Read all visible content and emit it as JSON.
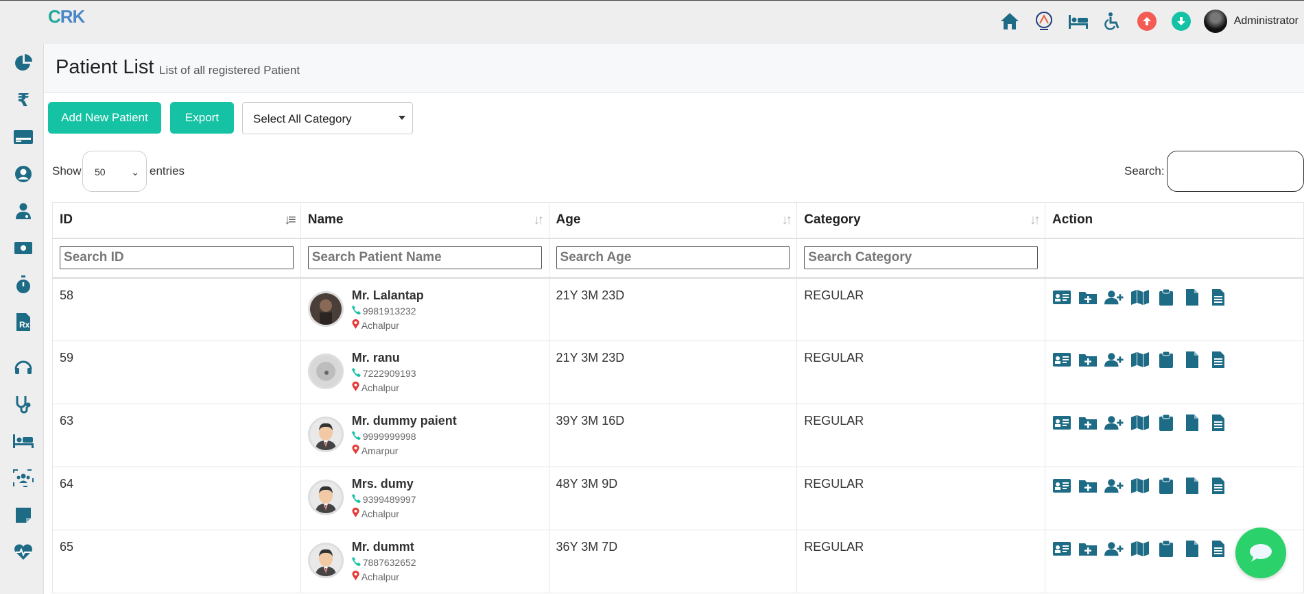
{
  "app": {
    "logo_part1": "C",
    "logo_part2": "RK",
    "user_name": "Administrator"
  },
  "colors": {
    "accent": "#15c3a4",
    "icon": "#1e6b86",
    "up": "#f25c54",
    "down": "#14c2a6",
    "chat": "#2bd16a"
  },
  "topbar": {
    "icons": [
      "home-icon",
      "abha-logo-icon",
      "hospital-bed-icon",
      "wheelchair-icon",
      "arrow-up-circle-icon",
      "arrow-down-circle-icon"
    ]
  },
  "sidebar": {
    "icons": [
      "pie-chart-icon",
      "rupee-icon",
      "id-card-icon",
      "user-circle-icon",
      "doctor-icon",
      "money-icon",
      "stopwatch-icon",
      "prescription-icon",
      "headset-icon",
      "stethoscope-icon",
      "bed-icon",
      "users-icon",
      "sticky-note-icon",
      "heartbeat-icon"
    ]
  },
  "page": {
    "title": "Patient List",
    "subtitle": "List of all registered Patient"
  },
  "toolbar": {
    "add_label": "Add New Patient",
    "export_label": "Export",
    "category_selected": "Select All Category"
  },
  "list_controls": {
    "show_label": "Show",
    "entries_value": "50",
    "entries_label": "entries",
    "search_label": "Search:"
  },
  "table": {
    "headers": {
      "id": "ID",
      "name": "Name",
      "age": "Age",
      "category": "Category",
      "action": "Action"
    },
    "filters": {
      "id": "Search ID",
      "name": "Search Patient Name",
      "age": "Search Age",
      "category": "Search Category"
    },
    "rows": [
      {
        "id": "58",
        "name": "Mr. Lalantap",
        "phone": "9981913232",
        "location": "Achalpur",
        "age": "21Y 3M 23D",
        "category": "REGULAR",
        "avatar": "photo"
      },
      {
        "id": "59",
        "name": "Mr. ranu",
        "phone": "7222909193",
        "location": "Achalpur",
        "age": "21Y 3M 23D",
        "category": "REGULAR",
        "avatar": "photo2"
      },
      {
        "id": "63",
        "name": "Mr. dummy paient",
        "phone": "9999999998",
        "location": "Amarpur",
        "age": "39Y 3M 16D",
        "category": "REGULAR",
        "avatar": "cartoon"
      },
      {
        "id": "64",
        "name": "Mrs. dumy",
        "phone": "9399489997",
        "location": "Achalpur",
        "age": "48Y 3M 9D",
        "category": "REGULAR",
        "avatar": "cartoon"
      },
      {
        "id": "65",
        "name": "Mr. dummt",
        "phone": "7887632652",
        "location": "Achalpur",
        "age": "36Y 3M 7D",
        "category": "REGULAR",
        "avatar": "cartoon"
      }
    ],
    "action_icons": [
      "id-card-icon",
      "folder-plus-icon",
      "user-plus-icon",
      "map-icon",
      "clipboard-icon",
      "file-icon",
      "file-text-icon"
    ]
  }
}
